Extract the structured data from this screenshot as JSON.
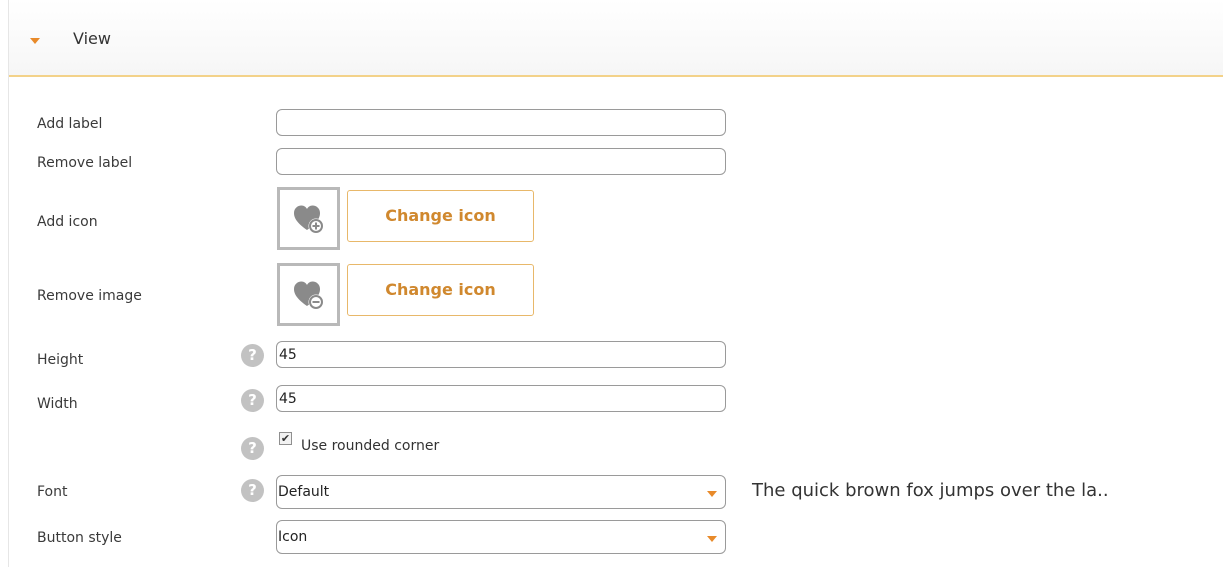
{
  "section": {
    "title": "View",
    "expanded": true
  },
  "fields": {
    "add_label": {
      "label": "Add label",
      "value": ""
    },
    "remove_label": {
      "label": "Remove label",
      "value": ""
    },
    "add_icon": {
      "label": "Add icon",
      "button": "Change icon",
      "icon": "heart-plus-icon"
    },
    "remove_image": {
      "label": "Remove image",
      "button": "Change icon",
      "icon": "heart-minus-icon"
    },
    "height": {
      "label": "Height",
      "value": "45"
    },
    "width": {
      "label": "Width",
      "value": "45"
    },
    "rounded_corner": {
      "label": "Use rounded corner",
      "checked": true
    },
    "font": {
      "label": "Font",
      "value": "Default",
      "preview": "The quick brown fox jumps over the la.."
    },
    "button_style": {
      "label": "Button style",
      "value": "Icon"
    }
  },
  "help_glyph": "?",
  "colors": {
    "accent": "#e88a2a",
    "button_text": "#d0882e",
    "header_border": "#f3d289"
  }
}
